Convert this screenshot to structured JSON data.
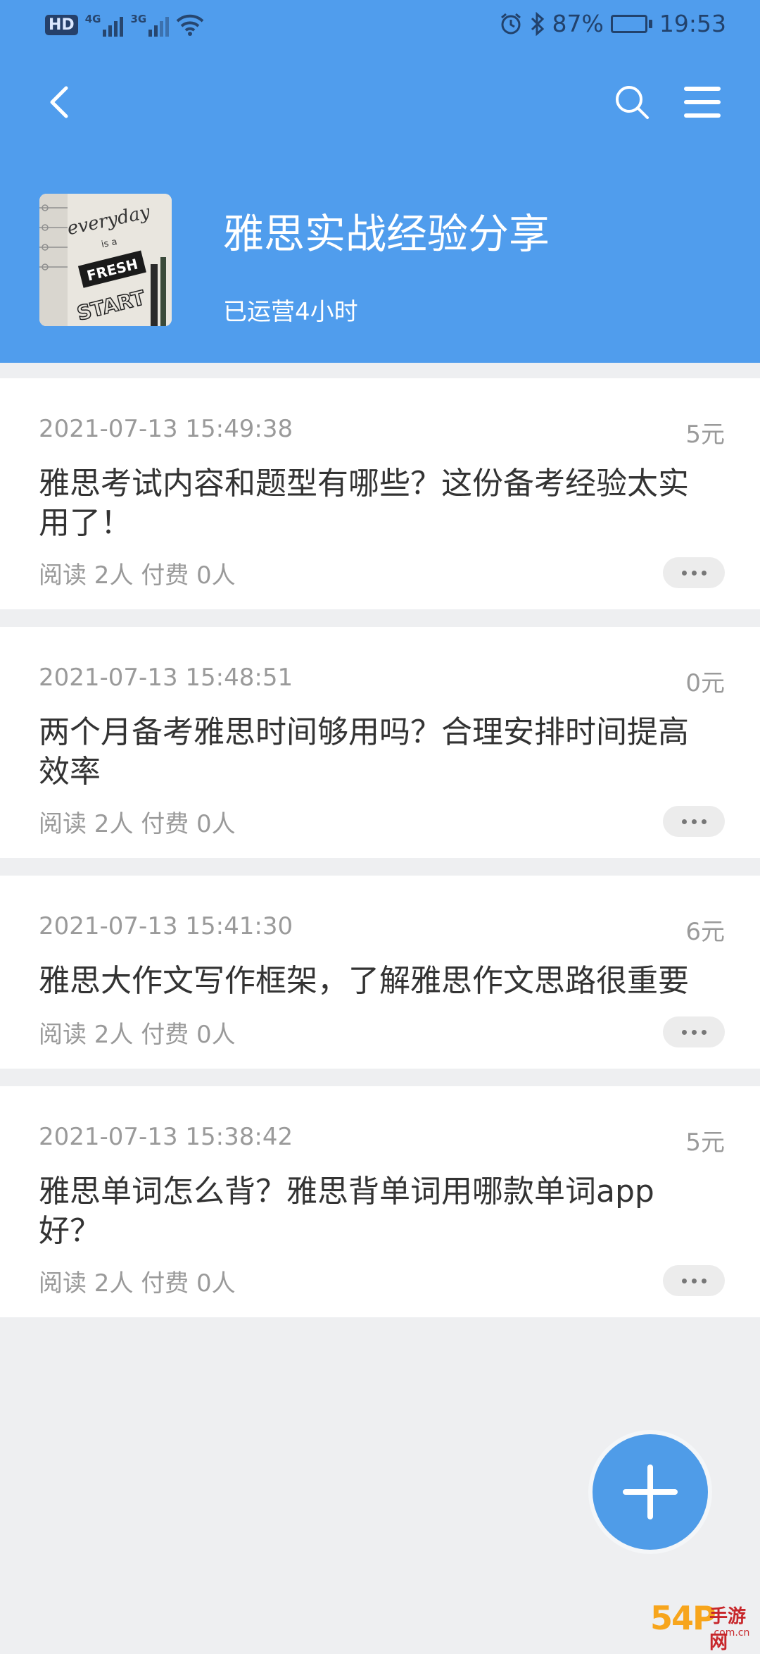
{
  "status_bar": {
    "hd": "HD",
    "net1": "4G",
    "net2": "3G",
    "battery": "87%",
    "battery_level": 0.87,
    "time": "19:53",
    "icons": [
      "alarm-icon",
      "bluetooth-icon",
      "battery-icon",
      "wifi-icon",
      "signal-icon"
    ]
  },
  "header": {
    "title": "雅思实战经验分享",
    "subtitle": "已运营4小时",
    "cover_text": [
      "everyday",
      "is a",
      "FRESH",
      "START"
    ],
    "bg_color": "#509ded"
  },
  "posts": [
    {
      "date": "2021-07-13 15:49:38",
      "price": "5元",
      "title": "雅思考试内容和题型有哪些？这份备考经验太实用了！",
      "stats": "阅读 2人 付费 0人"
    },
    {
      "date": "2021-07-13 15:48:51",
      "price": "0元",
      "title": "两个月备考雅思时间够用吗？合理安排时间提高效率",
      "stats": "阅读 2人 付费 0人"
    },
    {
      "date": "2021-07-13 15:41:30",
      "price": "6元",
      "title": "雅思大作文写作框架，了解雅思作文思路很重要",
      "stats": "阅读 2人 付费 0人"
    },
    {
      "date": "2021-07-13 15:38:42",
      "price": "5元",
      "title": "雅思单词怎么背？雅思背单词用哪款单词app好？",
      "stats": "阅读 2人 付费 0人"
    }
  ],
  "watermark": {
    "num": "54P",
    "cn": "手游网",
    "domain": ".com.cn"
  }
}
